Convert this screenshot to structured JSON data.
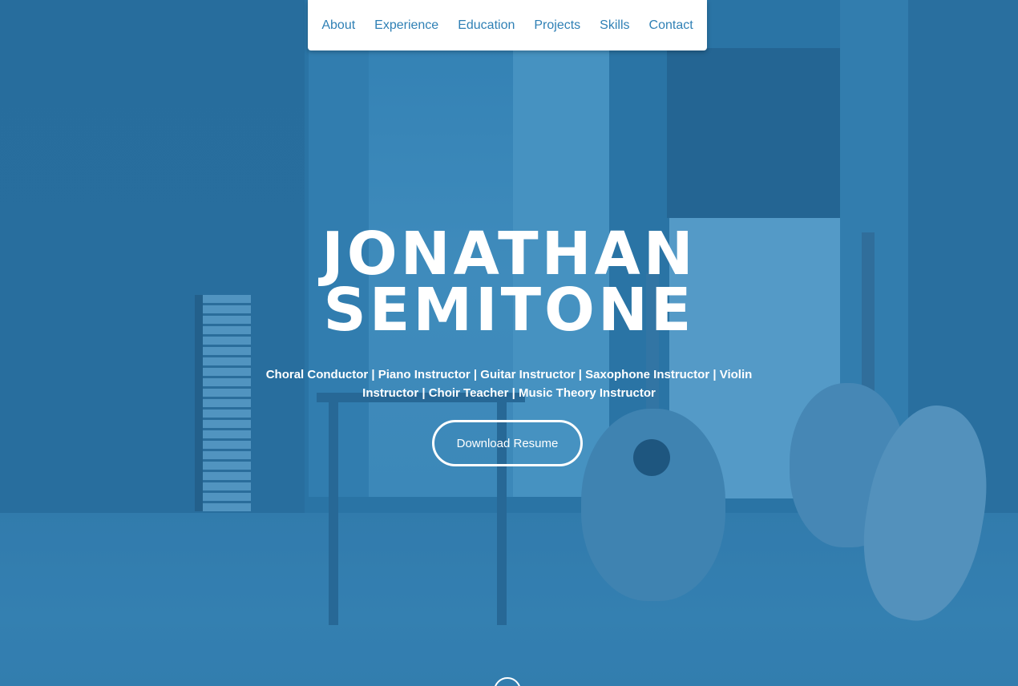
{
  "nav": {
    "items": [
      {
        "label": "About"
      },
      {
        "label": "Experience"
      },
      {
        "label": "Education"
      },
      {
        "label": "Projects"
      },
      {
        "label": "Skills"
      },
      {
        "label": "Contact"
      }
    ]
  },
  "hero": {
    "name_line1": "JONATHAN",
    "name_line2": "SEMITONE",
    "subtitle": "Choral Conductor | Piano Instructor | Guitar Instructor | Saxophone Instructor | Violin Instructor | Choir Teacher | Music Theory Instructor",
    "download_label": "Download Resume"
  },
  "icons": {
    "scroll_down": "scroll-down-icon"
  },
  "colors": {
    "accent": "#2f80b5",
    "overlay": "#2f79a8",
    "text_on_hero": "#ffffff"
  }
}
